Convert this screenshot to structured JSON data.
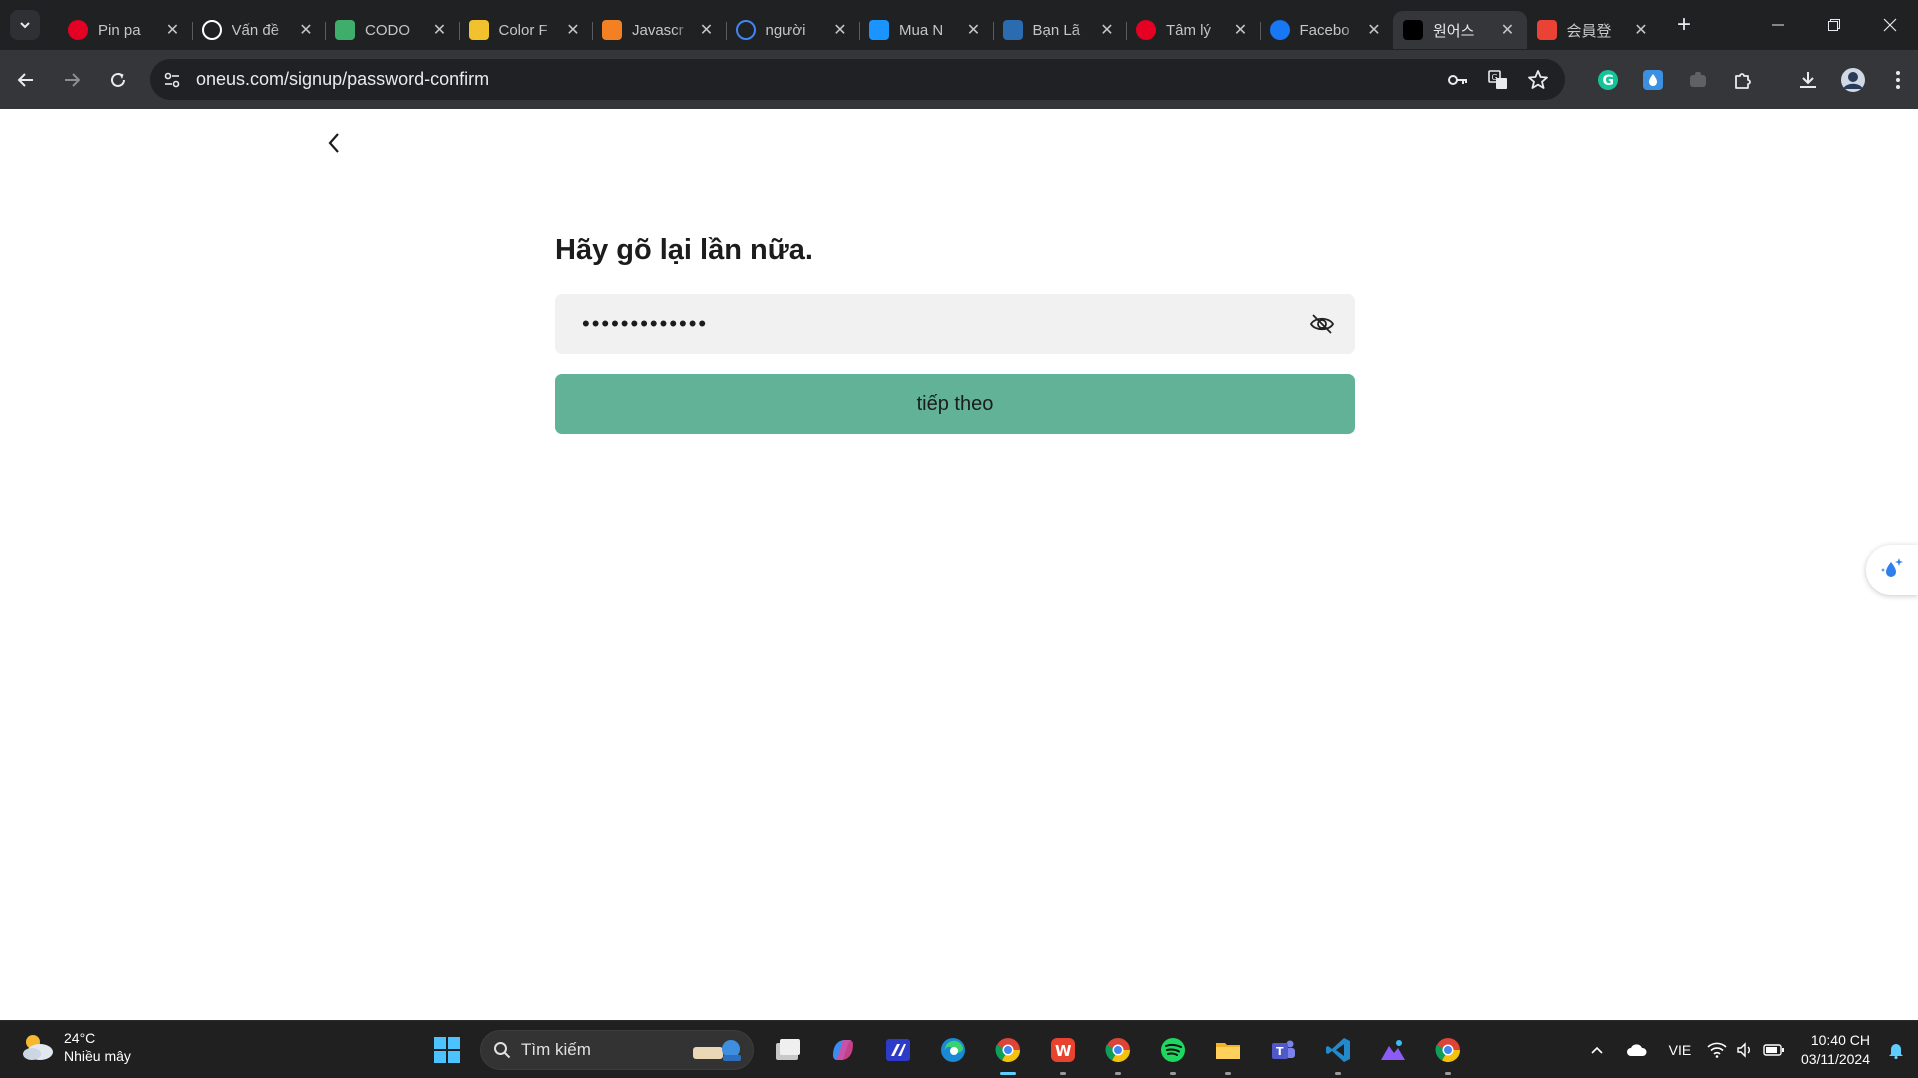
{
  "browser": {
    "tabs": [
      {
        "title": "Pin pa",
        "icon": "pinterest-icon",
        "color": "#e60023"
      },
      {
        "title": "Vấn đề",
        "icon": "chatgpt-icon",
        "color": "#ffffff"
      },
      {
        "title": "CODO",
        "icon": "codo-icon",
        "color": "#3fae6a"
      },
      {
        "title": "Color F",
        "icon": "color-palette-icon",
        "color": "#f2c12e"
      },
      {
        "title": "Javascr",
        "icon": "stackoverflow-icon",
        "color": "#f48024"
      },
      {
        "title": "người",
        "icon": "google-icon",
        "color": "#4285f4"
      },
      {
        "title": "Mua N",
        "icon": "tiki-icon",
        "color": "#1a94ff"
      },
      {
        "title": "Bạn Lã",
        "icon": "news-icon",
        "color": "#2b6cb0"
      },
      {
        "title": "Tâm lý",
        "icon": "pinterest-icon",
        "color": "#e60023"
      },
      {
        "title": "Facebo",
        "icon": "facebook-icon",
        "color": "#1877f2"
      },
      {
        "title": "원어스",
        "icon": "oneus-icon",
        "color": "#000000",
        "active": true
      },
      {
        "title": "会員登",
        "icon": "gmail-icon",
        "color": "#ea4335"
      }
    ],
    "url": "oneus.com/signup/password-confirm"
  },
  "page": {
    "heading": "Hãy gõ lại lần nữa.",
    "password_value": "•••••••••••••",
    "next_label": "tiếp theo",
    "accent_color": "#61b297"
  },
  "taskbar": {
    "temperature": "24°C",
    "weather": "Nhiều mây",
    "search_placeholder": "Tìm kiếm",
    "language": "VIE",
    "time": "10:40 CH",
    "date": "03/11/2024"
  }
}
